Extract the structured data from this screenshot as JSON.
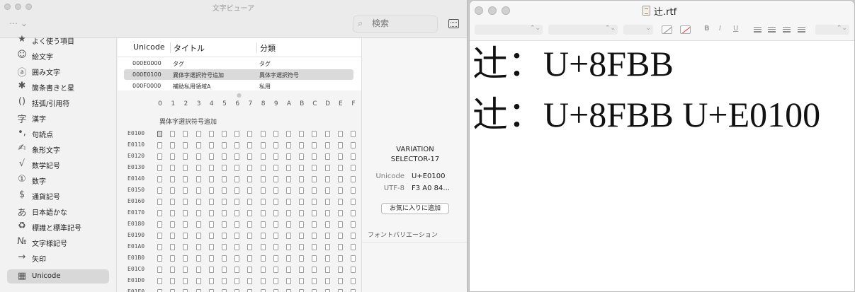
{
  "viewer": {
    "title": "文字ビューア",
    "more_label": "⋯ ⌄",
    "search_placeholder": "検索",
    "sidebar": [
      {
        "icon": "★",
        "label": "よく使う項目",
        "name": "favorites"
      },
      {
        "icon": "☺",
        "label": "絵文字",
        "name": "emoji"
      },
      {
        "icon": "ⓐ",
        "label": "囲み文字",
        "name": "enclosed"
      },
      {
        "icon": "✱",
        "label": "箇条書きと星",
        "name": "bullets-stars"
      },
      {
        "icon": "()",
        "label": "括弧/引用符",
        "name": "brackets"
      },
      {
        "icon": "字",
        "label": "漢字",
        "name": "kanji"
      },
      {
        "icon": "•,",
        "label": "句読点",
        "name": "punctuation"
      },
      {
        "icon": "✍",
        "label": "象形文字",
        "name": "pictographs"
      },
      {
        "icon": "√",
        "label": "数学記号",
        "name": "math"
      },
      {
        "icon": "①",
        "label": "数字",
        "name": "digits"
      },
      {
        "icon": "$",
        "label": "通貨記号",
        "name": "currency"
      },
      {
        "icon": "あ",
        "label": "日本語かな",
        "name": "kana"
      },
      {
        "icon": "♻",
        "label": "標識と標準記号",
        "name": "signs"
      },
      {
        "icon": "№",
        "label": "文字様記号",
        "name": "letterlike"
      },
      {
        "icon": "→",
        "label": "矢印",
        "name": "arrows"
      },
      {
        "icon": "▦",
        "label": "Unicode",
        "name": "unicode"
      }
    ],
    "table": {
      "headers": [
        "Unicode",
        "タイトル",
        "分類"
      ],
      "rows": [
        {
          "code": "000E0000",
          "title": "タグ",
          "category": "タグ"
        },
        {
          "code": "000E0100",
          "title": "異体字選択符号追加",
          "category": "異体字選択符号"
        },
        {
          "code": "000F0000",
          "title": "補助私用領域A",
          "category": "私用"
        }
      ]
    },
    "grid": {
      "col_headers": [
        "0",
        "1",
        "2",
        "3",
        "4",
        "5",
        "6",
        "7",
        "8",
        "9",
        "A",
        "B",
        "C",
        "D",
        "E",
        "F"
      ],
      "group_label": "異体字選択符号追加",
      "row_labels": [
        "E0100",
        "E0110",
        "E0120",
        "E0130",
        "E0140",
        "E0150",
        "E0160",
        "E0170",
        "E0180",
        "E0190",
        "E01A0",
        "E01B0",
        "E01C0",
        "E01D0",
        "E01E0"
      ]
    },
    "detail": {
      "name_line1": "VARIATION",
      "name_line2": "SELECTOR-17",
      "unicode_key": "Unicode",
      "unicode_val": "U+E0100",
      "utf8_key": "UTF-8",
      "utf8_val": "F3 A0 84...",
      "favorite_button": "お気に入りに追加",
      "font_variation_title": "フォントバリエーション"
    }
  },
  "editor": {
    "title": "辻.rtf",
    "toolbar": {
      "bold": "B",
      "italic": "I",
      "underline": "U",
      "updown": "⌃⌄",
      "dropdown": "⌄"
    },
    "lines": [
      "辻：U+8FBB",
      "辻：U+8FBB U+E0100"
    ]
  }
}
